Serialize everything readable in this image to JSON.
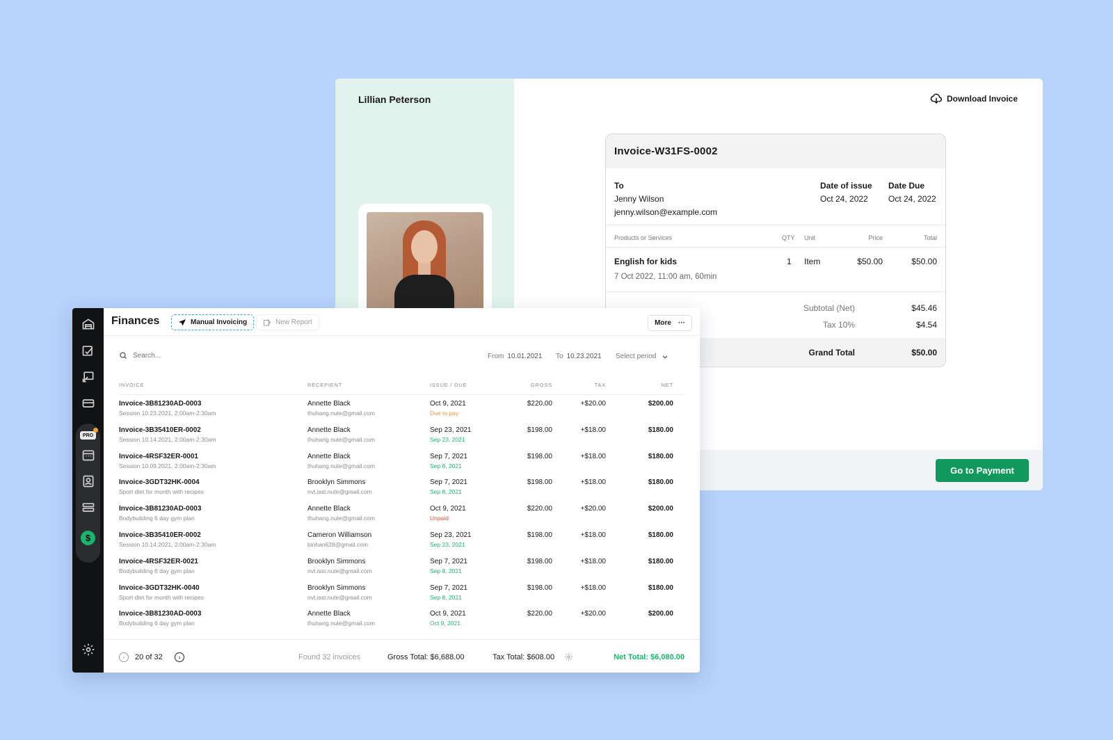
{
  "colors": {
    "background": "#b7d2fb",
    "accent_green": "#11995d",
    "net_green": "#19b56c",
    "due_orange": "#e7982f",
    "unpaid_red": "#e0512d",
    "paid_green": "#19b56c",
    "sidebar": "#111214"
  },
  "invoice": {
    "client_name": "Lillian Peterson",
    "download_label": "Download Invoice",
    "number": "Invoice-W31FS-0002",
    "to_label": "To",
    "to_name": "Jenny Wilson",
    "to_email": "jenny.wilson@example.com",
    "issue_label": "Date of issue",
    "issue_date": "Oct 24, 2022",
    "due_label": "Date Due",
    "due_date": "Oct 24, 2022",
    "columns": {
      "products": "Products or Services",
      "qty": "QTY",
      "unit": "Unit",
      "price": "Price",
      "total": "Total"
    },
    "item": {
      "name": "English for kids",
      "detail": "7 Oct 2022, 11:00 am, 60min",
      "qty": "1",
      "unit": "Item",
      "price": "$50.00",
      "total": "$50.00"
    },
    "subtotal_label": "Subtotal (Net)",
    "subtotal": "$45.46",
    "tax_label": "Tax 10%",
    "tax": "$4.54",
    "grand_label": "Grand Total",
    "grand": "$50.00",
    "pay_label": "Go to Payment"
  },
  "finances": {
    "title": "Finances",
    "tab_manual": "Manual Invoicing",
    "tab_new_report": "New Report",
    "more_label": "More",
    "search_placeholder": "Search...",
    "from_label": "From",
    "from_value": "10.01.2021",
    "to_label": "To",
    "to_value": "10.23.2021",
    "period_label": "Select period",
    "columns": {
      "invoice": "INVOICE",
      "recipient": "RECEPIENT",
      "issue_due": "ISSUE / DUE",
      "gross": "GROSS",
      "tax": "TAX",
      "net": "NET"
    },
    "rows": [
      {
        "invoice": "Invoice-3B81230AD-0003",
        "desc": "Session 10.23.2021, 2:00am-2:30am",
        "recipient": "Annette Black",
        "email": "thuhang.nute@gmail.com",
        "issue": "Oct 9, 2021",
        "due": "Due to pay",
        "due_status": "due",
        "gross": "$220.00",
        "tax": "+$20.00",
        "net": "$200.00"
      },
      {
        "invoice": "Invoice-3B35410ER-0002",
        "desc": "Session 10.14.2021, 2:00am-2:30am",
        "recipient": "Annette Black",
        "email": "thuhang.nute@gmail.com",
        "issue": "Sep 23, 2021",
        "due": "Sep 23, 2021",
        "due_status": "paid",
        "gross": "$198.00",
        "tax": "+$18.00",
        "net": "$180.00"
      },
      {
        "invoice": "Invoice-4RSF32ER-0001",
        "desc": "Session 10.09.2021, 2:00am-2:30am",
        "recipient": "Annette Black",
        "email": "thuhang.nute@gmail.com",
        "issue": "Sep 7, 2021",
        "due": "Sep 8, 2021",
        "due_status": "paid",
        "gross": "$198.00",
        "tax": "+$18.00",
        "net": "$180.00"
      },
      {
        "invoice": "Invoice-3GDT32HK-0004",
        "desc": "Sport diet for month with recipes",
        "recipient": "Brooklyn Simmons",
        "email": "nvt.isst.nute@gmail.com",
        "issue": "Sep 7, 2021",
        "due": "Sep 8, 2021",
        "due_status": "paid",
        "gross": "$198.00",
        "tax": "+$18.00",
        "net": "$180.00"
      },
      {
        "invoice": "Invoice-3B81230AD-0003",
        "desc": "Bodybuilding 6 day gym plan",
        "recipient": "Annette Black",
        "email": "thuhang.nute@gmail.com",
        "issue": "Oct 9, 2021",
        "due": "Unpaid",
        "due_status": "unpaid",
        "gross": "$220.00",
        "tax": "+$20.00",
        "net": "$200.00"
      },
      {
        "invoice": "Invoice-3B35410ER-0002",
        "desc": "Session 10.14.2021, 2:00am-2:30am",
        "recipient": "Cameron Williamson",
        "email": "binhan628@gmail.com",
        "issue": "Sep 23, 2021",
        "due": "Sep 23, 2021",
        "due_status": "paid",
        "gross": "$198.00",
        "tax": "+$18.00",
        "net": "$180.00"
      },
      {
        "invoice": "Invoice-4RSF32ER-0021",
        "desc": "Bodybuilding 6 day gym plan",
        "recipient": "Brooklyn Simmons",
        "email": "nvt.isst.nute@gmail.com",
        "issue": "Sep 7, 2021",
        "due": "Sep 8, 2021",
        "due_status": "paid",
        "gross": "$198.00",
        "tax": "+$18.00",
        "net": "$180.00"
      },
      {
        "invoice": "Invoice-3GDT32HK-0040",
        "desc": "Sport diet for month with recipes",
        "recipient": "Brooklyn Simmons",
        "email": "nvt.isst.nute@gmail.com",
        "issue": "Sep 7, 2021",
        "due": "Sep 8, 2021",
        "due_status": "paid",
        "gross": "$198.00",
        "tax": "+$18.00",
        "net": "$180.00"
      },
      {
        "invoice": "Invoice-3B81230AD-0003",
        "desc": "Bodybuilding 6 day gym plan",
        "recipient": "Annette Black",
        "email": "thuhang.nute@gmail.com",
        "issue": "Oct 9, 2021",
        "due": "Oct 9, 2021",
        "due_status": "paid",
        "gross": "$220.00",
        "tax": "+$20.00",
        "net": "$200.00"
      }
    ],
    "pagination": "20 of 32",
    "found": "Found 32 invoices",
    "gross_total": "Gross Total: $6,688.00",
    "tax_total": "Tax Total: $608.00",
    "net_total": "Net Total: $6,080.00",
    "sidebar_icons": [
      "garage-icon",
      "edit-board-icon",
      "screen-share-icon",
      "card-icon",
      "pro-icon",
      "calendar-icon",
      "contact-icon",
      "storage-icon",
      "dollar-icon",
      "settings-gear-icon"
    ]
  }
}
